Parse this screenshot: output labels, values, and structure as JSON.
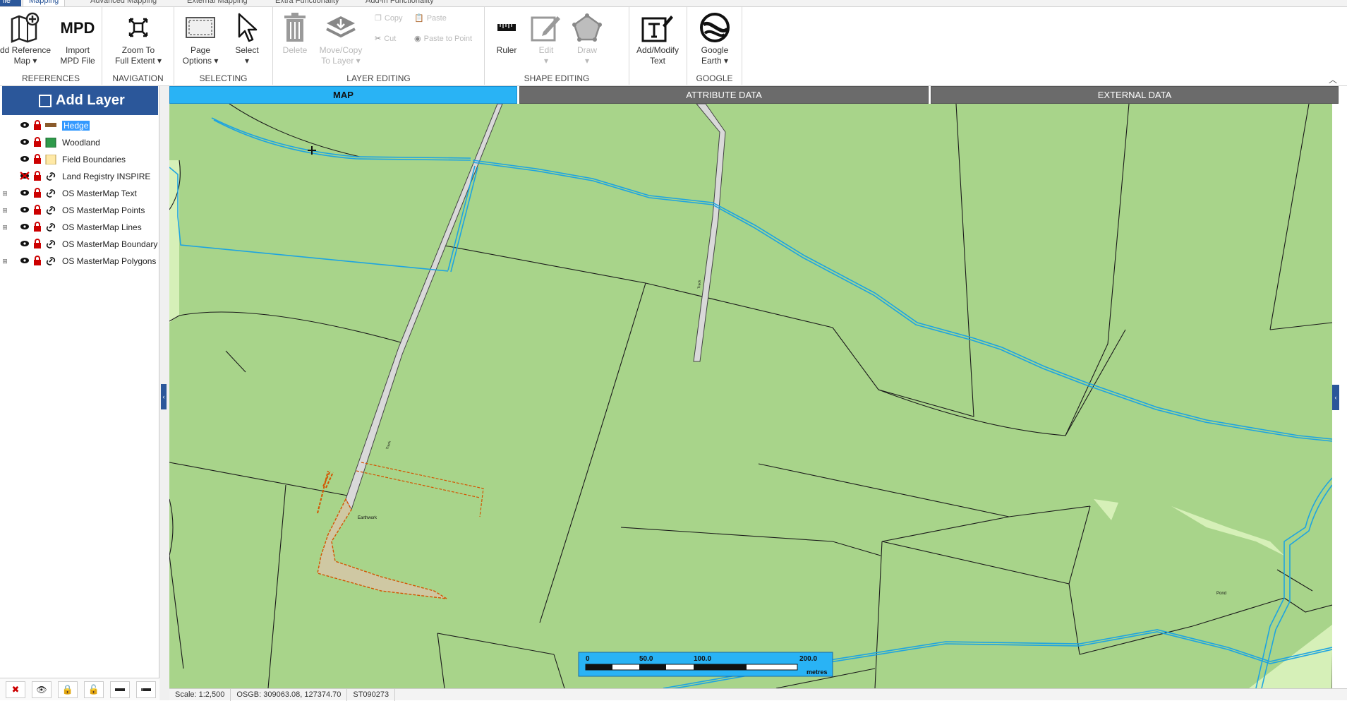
{
  "ribbon_tabs": {
    "file": "ile",
    "active": "Mapping",
    "others": [
      "Advanced Mapping",
      "External Mapping",
      "Extra Functionality",
      "Add-in Functionality"
    ]
  },
  "groups": {
    "references": {
      "label": "REFERENCES",
      "add_ref": "dd Reference\nMap ▾",
      "import_mpd": "Import\nMPD File"
    },
    "navigation": {
      "label": "NAVIGATION",
      "zoom": "Zoom To\nFull Extent ▾"
    },
    "selecting": {
      "label": "SELECTING",
      "page_options": "Page\nOptions ▾",
      "select": "Select\n▾"
    },
    "layer_editing": {
      "label": "LAYER EDITING",
      "delete": "Delete",
      "move_copy": "Move/Copy\nTo Layer ▾",
      "copy": "Copy",
      "paste": "Paste",
      "cut": "Cut",
      "paste_to_point": "Paste to Point"
    },
    "shape_editing": {
      "label": "SHAPE EDITING",
      "ruler": "Ruler",
      "edit": "Edit\n▾",
      "draw": "Draw\n▾",
      "add_modify_text": "Add/Modify\nText"
    },
    "google": {
      "label": "GOOGLE",
      "google_earth": "Google\nEarth ▾"
    }
  },
  "mpd_text": "MPD",
  "add_layer": "Add Layer",
  "layers": [
    {
      "name": "Hedge",
      "selected": true,
      "expandable": false,
      "visible": true,
      "locked": true,
      "symbol": "hedge"
    },
    {
      "name": "Woodland",
      "selected": false,
      "expandable": false,
      "visible": true,
      "locked": true,
      "symbol": "woodland"
    },
    {
      "name": "Field Boundaries",
      "selected": false,
      "expandable": false,
      "visible": true,
      "locked": true,
      "symbol": "field"
    },
    {
      "name": "Land Registry INSPIRE",
      "selected": false,
      "expandable": false,
      "visible": false,
      "locked": true,
      "symbol": "link"
    },
    {
      "name": "OS MasterMap Text",
      "selected": false,
      "expandable": true,
      "visible": true,
      "locked": true,
      "symbol": "link"
    },
    {
      "name": "OS MasterMap Points",
      "selected": false,
      "expandable": true,
      "visible": true,
      "locked": true,
      "symbol": "link"
    },
    {
      "name": "OS MasterMap Lines",
      "selected": false,
      "expandable": true,
      "visible": true,
      "locked": true,
      "symbol": "link"
    },
    {
      "name": "OS MasterMap Boundary",
      "selected": false,
      "expandable": false,
      "visible": true,
      "locked": true,
      "symbol": "link"
    },
    {
      "name": "OS MasterMap Polygons",
      "selected": false,
      "expandable": true,
      "visible": true,
      "locked": true,
      "symbol": "link"
    }
  ],
  "view_tabs": {
    "map": "MAP",
    "attribute": "ATTRIBUTE DATA",
    "external": "EXTERNAL DATA"
  },
  "scale_bar": {
    "t0": "0",
    "t1": "50.0",
    "t2": "100.0",
    "t3": "200.0",
    "unit": "metres"
  },
  "map_labels": {
    "earthwork": "Earthwork",
    "track1": "Track",
    "track2": "Track",
    "pond": "Pond"
  },
  "status": {
    "scale": "Scale: 1:2,500",
    "osgb": "OSGB: 309063.08, 127374.70",
    "grid": "ST090273"
  },
  "colors": {
    "accent": "#2b579a",
    "map_field": "#a8d48a",
    "water": "#29b3f5",
    "hedge": "#d35400",
    "tab_active": "#29b3f5"
  }
}
